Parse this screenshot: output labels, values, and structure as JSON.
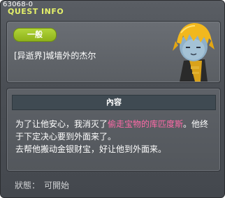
{
  "window": {
    "quest_id": "63068-0",
    "title": "QUEST INFO"
  },
  "quest": {
    "category": "一般",
    "name": "[异逝界]城墙外的杰尔",
    "content_label": "內容",
    "description": {
      "part1": "为了让他安心，我消灭了",
      "highlight": "偷走宝物的库匹度斯",
      "part2": "。他终于下定决心要到外面来了。",
      "line2": "去帮他搬动金银财宝，好让他到外面来。"
    },
    "status_label": "狀態：",
    "status_value": "可開始"
  },
  "colors": {
    "title": "#e4f06a",
    "badge": "#9cc22a",
    "highlight": "#ff6aa8",
    "panel": "#5a5e63"
  },
  "icons": {
    "npc": "npc-portrait-zombie"
  }
}
